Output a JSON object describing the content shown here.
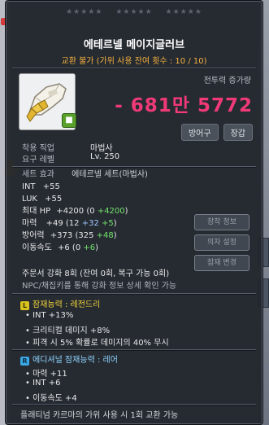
{
  "stars": [
    "★★★★★",
    "★★★★★",
    "★★★★★"
  ],
  "item": {
    "name": "에테르넬 메이지글러브",
    "trade_note": "교환 불가 (가위 사용 잔여 횟수 : 10 / 10)"
  },
  "power": {
    "label": "전투력 증가량",
    "value": "- 681만 5772"
  },
  "tags": [
    "방어구",
    "장갑"
  ],
  "requirements": [
    {
      "label": "착용 직업",
      "value": "마법사"
    },
    {
      "label": "요구 레벨",
      "value": "Lv. 250"
    }
  ],
  "set_effect": {
    "label": "세트 효과",
    "value": "에테르넬 세트(마법사)"
  },
  "stats": [
    {
      "name": "INT",
      "value": "+55"
    },
    {
      "name": "LUK",
      "value": "+55"
    }
  ],
  "hp": {
    "name": "최대 HP",
    "total": "+4200",
    "base": "0",
    "bonus": "+4200"
  },
  "magic": {
    "name": "마력",
    "total": "+49",
    "base": "12",
    "add": "+32",
    "star": "+5"
  },
  "defense": {
    "name": "방어력",
    "total": "+373",
    "base": "325",
    "star": "+48"
  },
  "speed": {
    "name": "이동속도",
    "total": "+6",
    "base": "0",
    "star": "+6"
  },
  "side_buttons": [
    "장착 정보",
    "의자 설정",
    "잠재 변경"
  ],
  "scroll_info": "주문서 강화 8회 (잔여 0회, 복구 가능 0회)",
  "npc_note": "NPC/채집키를 통해 강화 정보 상세 확인 가능",
  "potential": {
    "icon": "L",
    "title": "잠재능력 : 레전드리",
    "lines": [
      "INT +13%",
      "크리티컬 데미지 +8%",
      "피격 시 5% 확률로 데미지의 40% 무시"
    ]
  },
  "additional": {
    "icon": "R",
    "title": "에디셔널 잠재능력 : 레어",
    "lines": [
      "마력 +11",
      "INT +6",
      "이동속도 +4"
    ]
  },
  "karma": "플래티넘 카르마의 가위 사용 시 1회 교환 가능",
  "colors": {
    "power": "#f03a78",
    "trade": "#f5b13d",
    "legendary": "#f4d53a",
    "rare": "#8fd6ff",
    "bonus_green": "#72e36a",
    "bonus_blue": "#9fc7ff"
  }
}
